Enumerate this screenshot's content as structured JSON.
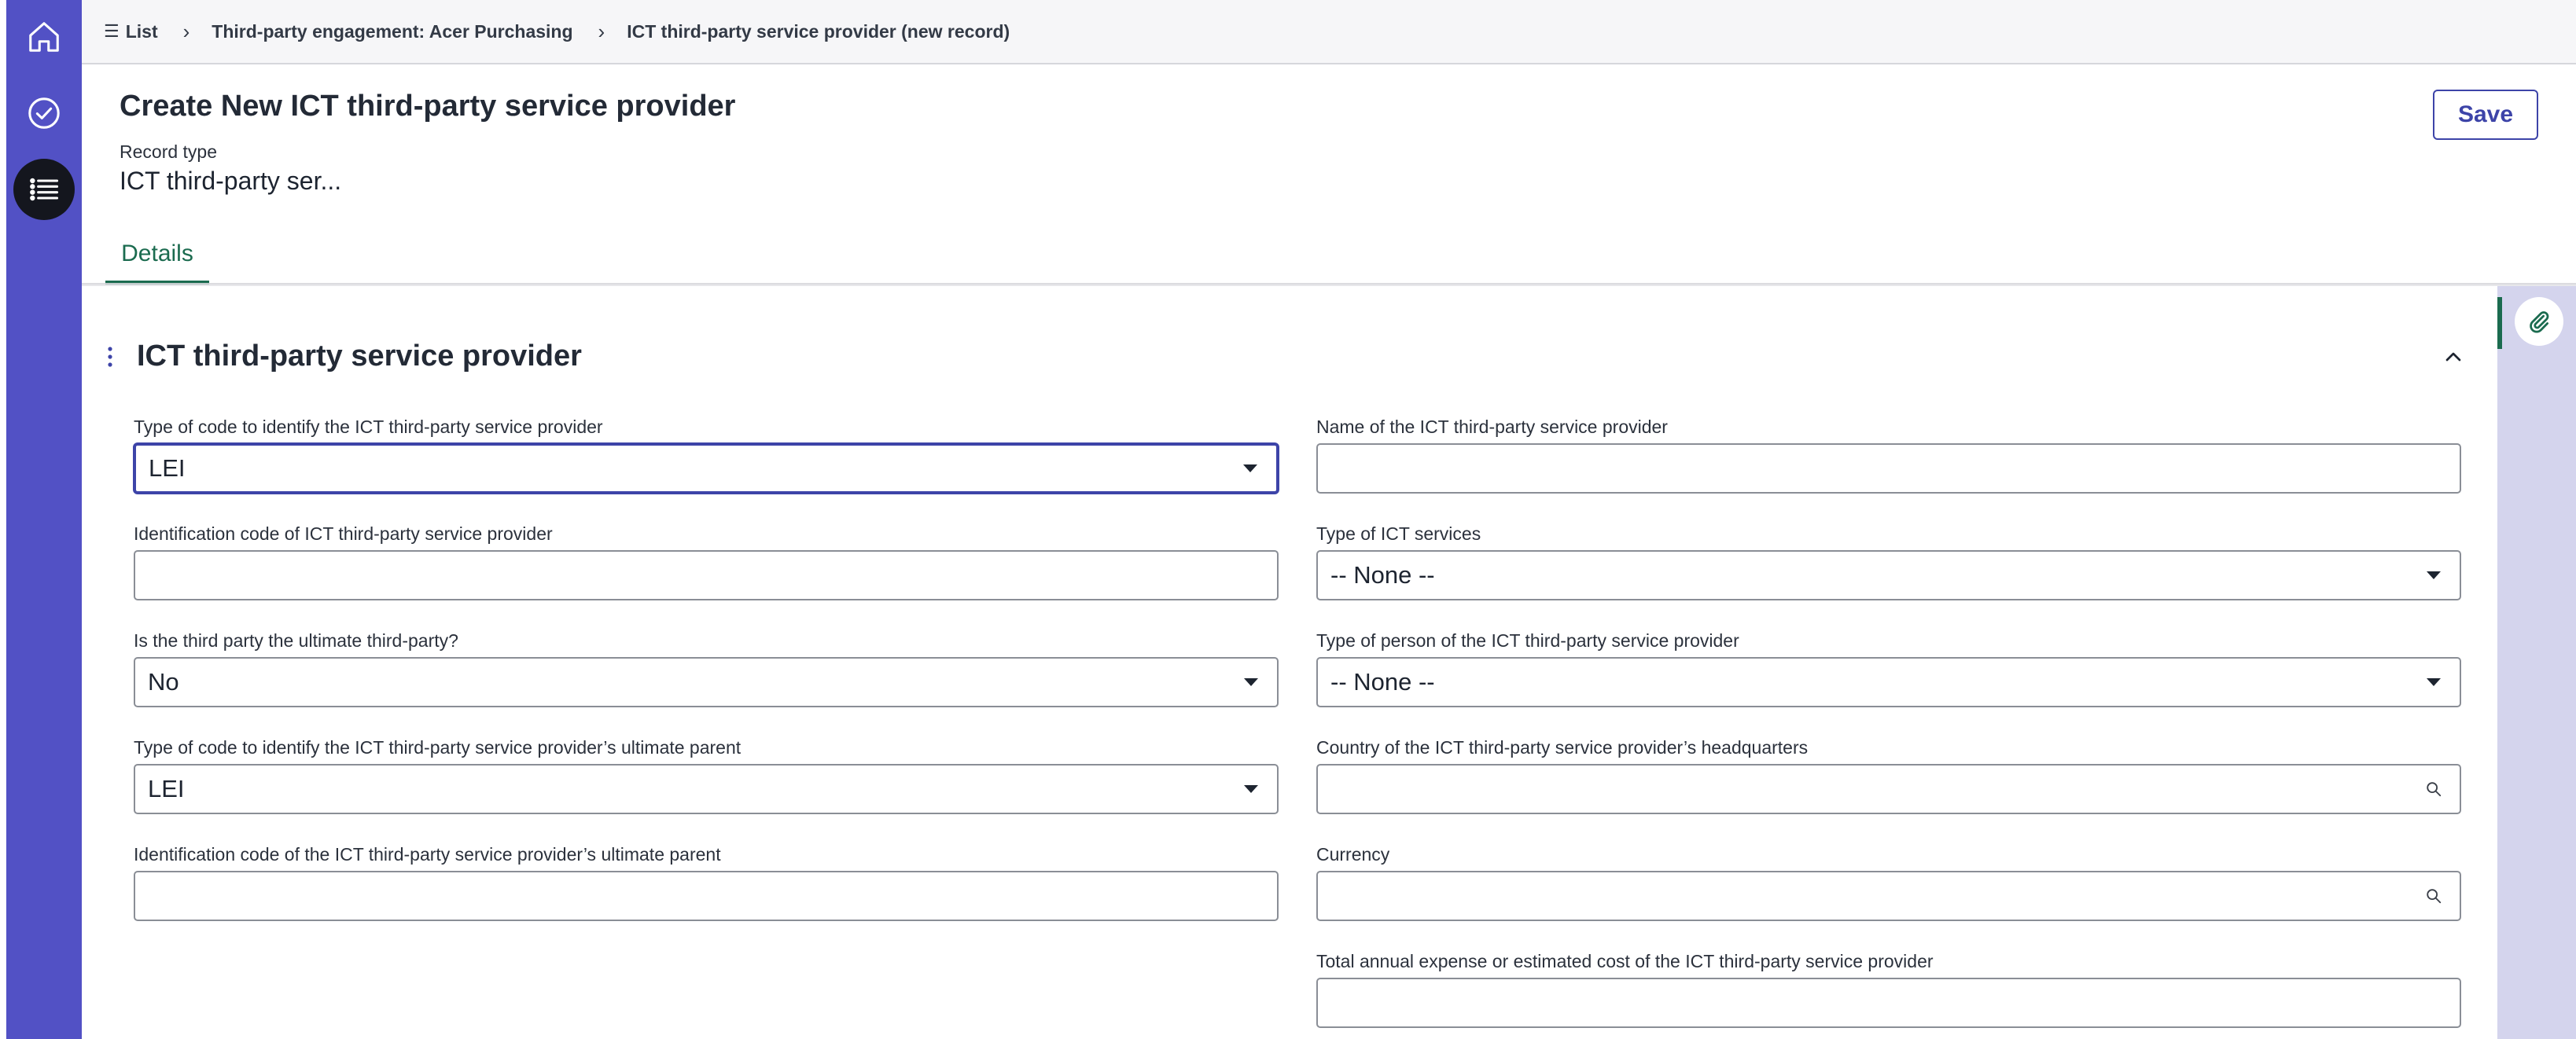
{
  "breadcrumb": {
    "list_label": "List",
    "parent_label": "Third-party engagement: Acer Purchasing",
    "current_label": "ICT third-party service provider (new record)"
  },
  "nav_rail": {
    "icons": [
      "home-icon",
      "check-circle-icon",
      "list-icon"
    ],
    "color": "#5251c5"
  },
  "header": {
    "title": "Create New ICT third-party service provider",
    "record_type_label": "Record type",
    "record_type_value": "ICT third-party ser...",
    "save_label": "Save"
  },
  "tabs": [
    {
      "label": "Details",
      "active": true
    }
  ],
  "section": {
    "title": "ICT third-party service provider"
  },
  "form": {
    "left": [
      {
        "label": "Type of code to identify the ICT third-party service provider",
        "value": "LEI",
        "kind": "select",
        "focused": true
      },
      {
        "label": "Identification code of ICT third-party service provider",
        "value": "",
        "kind": "text"
      },
      {
        "label": "Is the third party the ultimate third-party?",
        "value": "No",
        "kind": "select"
      },
      {
        "label": "Type of code to identify the ICT third-party service provider’s ultimate parent",
        "value": "LEI",
        "kind": "select"
      },
      {
        "label": "Identification code of the ICT third-party service provider’s ultimate parent",
        "value": "",
        "kind": "text"
      }
    ],
    "right": [
      {
        "label": "Name of the ICT third-party service provider",
        "value": "",
        "kind": "text"
      },
      {
        "label": "Type of ICT services",
        "value": "-- None --",
        "kind": "select"
      },
      {
        "label": "Type of person of the ICT third-party service provider",
        "value": "-- None --",
        "kind": "select"
      },
      {
        "label": "Country of the ICT third-party service provider’s headquarters",
        "value": "",
        "kind": "lookup"
      },
      {
        "label": "Currency",
        "value": "",
        "kind": "lookup"
      },
      {
        "label": "Total annual expense or estimated cost of the ICT third-party service provider",
        "value": "",
        "kind": "text"
      }
    ]
  },
  "colors": {
    "accent": "#3d44a8",
    "tab_active": "#1b6b4f",
    "rail": "#5251c5",
    "right_rail": "#d4d4ed"
  }
}
